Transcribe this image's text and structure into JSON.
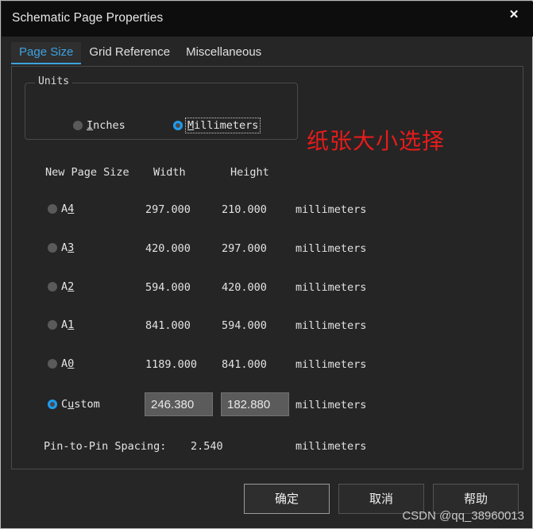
{
  "window": {
    "title": "Schematic Page Properties",
    "close_icon": "close-icon",
    "close_glyph": "✕"
  },
  "tabs": [
    {
      "label": "Page Size",
      "active": true
    },
    {
      "label": "Grid Reference",
      "active": false
    },
    {
      "label": "Miscellaneous",
      "active": false
    }
  ],
  "units_group": {
    "legend": "Units",
    "options": [
      {
        "label": "Inches",
        "mnemonic": "I",
        "selected": false
      },
      {
        "label": "Millimeters",
        "mnemonic": "M",
        "selected": true,
        "focused": true
      }
    ]
  },
  "page_size_table": {
    "headers": {
      "name": "New Page Size",
      "width": "Width",
      "height": "Height"
    },
    "rows": [
      {
        "label": "A4",
        "mnemonic": "4",
        "width": "297.000",
        "height": "210.000",
        "unit": "millimeters",
        "selected": false
      },
      {
        "label": "A3",
        "mnemonic": "3",
        "width": "420.000",
        "height": "297.000",
        "unit": "millimeters",
        "selected": false
      },
      {
        "label": "A2",
        "mnemonic": "2",
        "width": "594.000",
        "height": "420.000",
        "unit": "millimeters",
        "selected": false
      },
      {
        "label": "A1",
        "mnemonic": "1",
        "width": "841.000",
        "height": "594.000",
        "unit": "millimeters",
        "selected": false
      },
      {
        "label": "A0",
        "mnemonic": "0",
        "width": "1189.000",
        "height": "841.000",
        "unit": "millimeters",
        "selected": false
      }
    ],
    "custom": {
      "label_before": "C",
      "mnemonic": "u",
      "label_after": "stom",
      "selected": true,
      "width_value": "246.380",
      "height_value": "182.880",
      "unit": "millimeters"
    }
  },
  "pin_spacing": {
    "label": "Pin-to-Pin Spacing:",
    "value": "2.540",
    "unit": "millimeters"
  },
  "annotation": {
    "text": "纸张大小选择",
    "color": "#e81b1b"
  },
  "buttons": {
    "ok": "确定",
    "cancel": "取消",
    "help": "帮助"
  },
  "watermark": "CSDN @qq_38960013",
  "colors": {
    "accent": "#3da2e0",
    "radio_selected": "#1d9bf0",
    "dialog_bg": "#262626",
    "titlebar_bg": "#0d0d0d",
    "panel_bg": "#252525"
  }
}
